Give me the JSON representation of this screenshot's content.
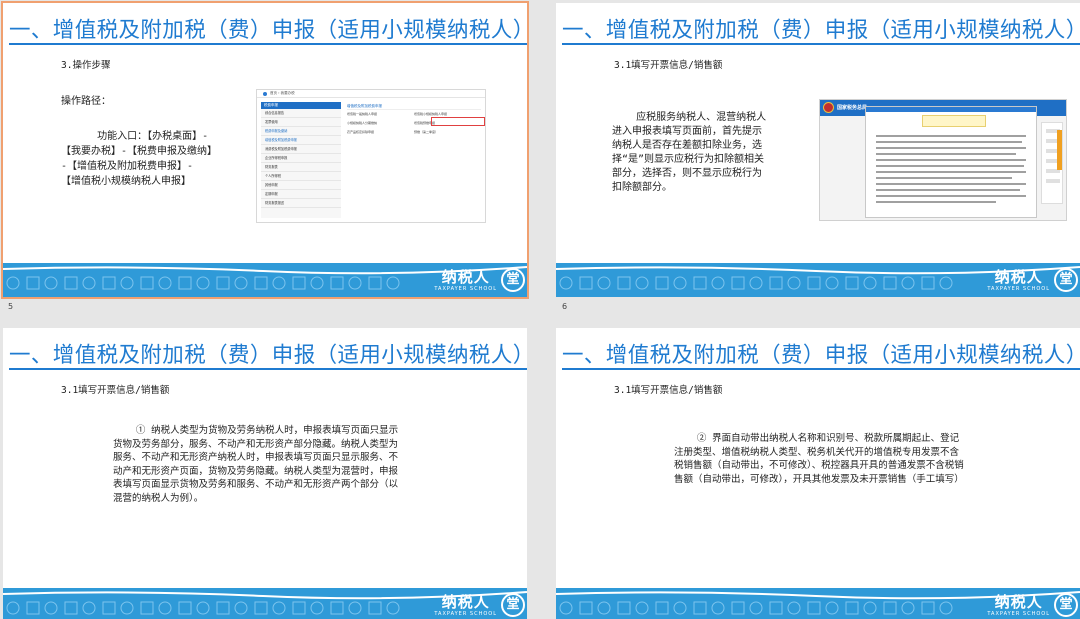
{
  "slides": [
    {
      "number": "5",
      "title": "一、增值税及附加税（费）申报（适用小规模纳税人）",
      "subtitle": "3.操作步骤",
      "body_heading": "操作路径：",
      "body": "      功能入口：【办税桌面】-【我要办税】-【税费申报及缴纳】-【增值税及附加税费申报】-【增值税小规模纳税人申报】",
      "screenshot": {
        "breadcrumb": "首页 › 我要办税",
        "menu_header": "税费申报",
        "menu_items": [
          "综合信息报告",
          "发票使用",
          "税费申报及缴纳",
          "增值税及附加税费申报",
          "消费税及附加税费申报",
          "企业所得税申报",
          "财务报表",
          "个人所得税",
          "其他申报",
          "定期申报",
          "财务报表报送"
        ],
        "panel_title": "增值税及附加税费申报",
        "rows": [
          [
            "增值税一般纳税人申报",
            "增值税小规模纳税人申报"
          ],
          [
            "小规模纳税人分期缴纳",
            "增值税预缴申报"
          ],
          [
            "农产品核定扣除申报",
            "预缴（第二季度）"
          ]
        ]
      }
    },
    {
      "number": "6",
      "title": "一、增值税及附加税（费）申报（适用小规模纳税人）",
      "subtitle": "3.1填写开票信息/销售额",
      "body": "    应税服务纳税人、混营纳税人进入申报表填写页面前，首先提示纳税人是否存在差额扣除业务，选择“是”则显示应税行为扣除额相关部分，选择否，则不显示应税行为扣除额部分。",
      "screenshot": {
        "header_text": "国家税务总局"
      }
    },
    {
      "number": "",
      "title": "一、增值税及附加税（费）申报（适用小规模纳税人）",
      "subtitle": "3.1填写开票信息/销售额",
      "body": "    ① 纳税人类型为货物及劳务纳税人时，申报表填写页面只显示货物及劳务部分，服务、不动产和无形资产部分隐藏。纳税人类型为服务、不动产和无形资产纳税人时，申报表填写页面只显示服务、不动产和无形资产页面，货物及劳务隐藏。纳税人类型为混营时，申报表填写页面显示货物及劳务和服务、不动产和无形资产两个部分（以混营的纳税人为例）。"
    },
    {
      "number": "",
      "title": "一、增值税及附加税（费）申报（适用小规模纳税人）",
      "subtitle": "3.1填写开票信息/销售额",
      "body": "    ② 界面自动带出纳税人名称和识别号、税款所属期起止、登记注册类型、增值税纳税人类型、税务机关代开的增值税专用发票不含税销售额（自动带出，不可修改）、税控器具开具的普通发票不含税销售额（自动带出，可修改），开具其他发票及未开票销售（手工填写）"
    }
  ],
  "footer": {
    "brand": "纳税人",
    "brand_sub": "TAXPAYER SCHOOL",
    "logo_char": "堂"
  },
  "colors": {
    "title_blue": "#1f7bd0",
    "footer_blue": "#2f9ad8",
    "selection": "#f0a070"
  }
}
